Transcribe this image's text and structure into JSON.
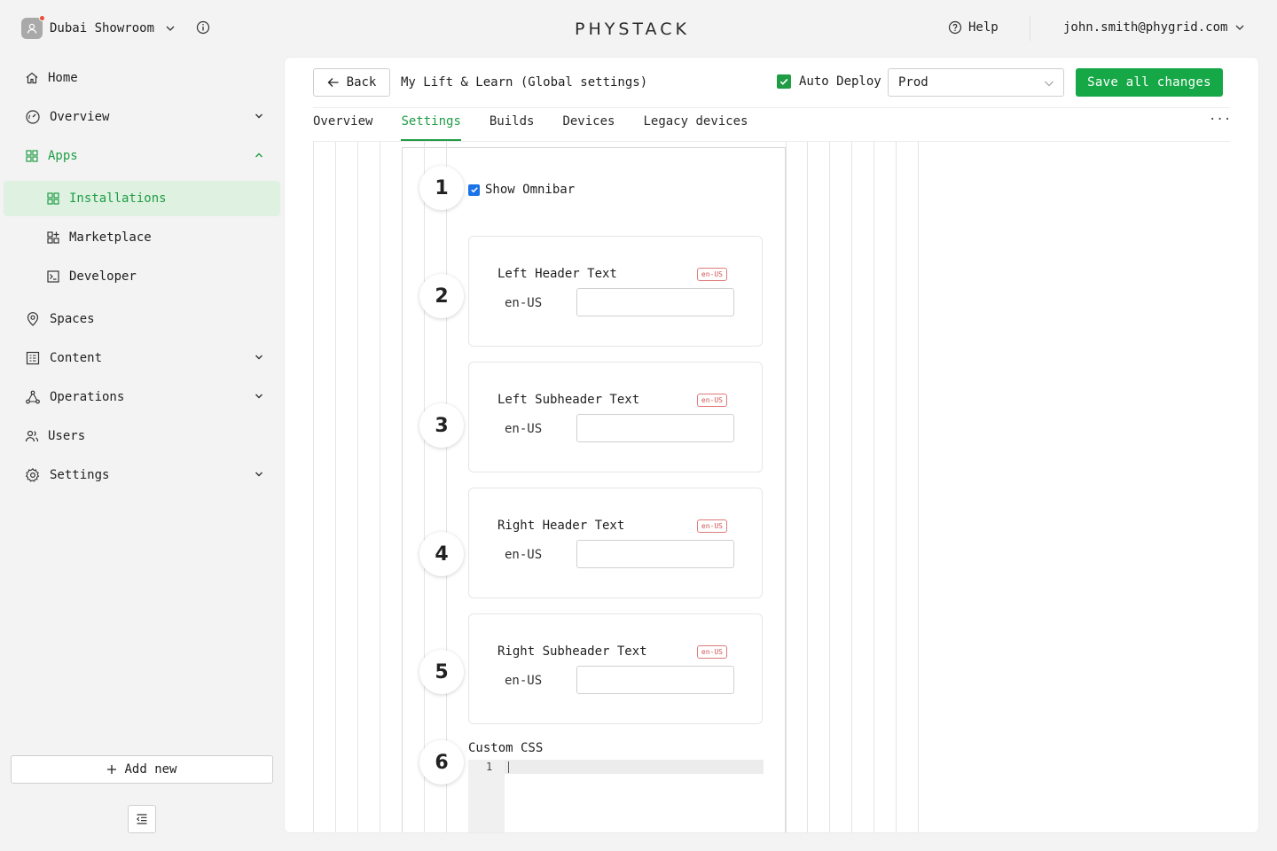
{
  "header": {
    "workspace_name": "Dubai Showroom",
    "logo_text": "PHYSTACK",
    "help_label": "Help",
    "user_email": "john.smith@phygrid.com"
  },
  "sidebar": {
    "items": [
      {
        "label": "Home",
        "icon": "home-icon"
      },
      {
        "label": "Overview",
        "icon": "gauge-icon"
      },
      {
        "label": "Apps",
        "icon": "grid-icon",
        "expanded": true
      },
      {
        "label": "Installations",
        "icon": "grid-icon",
        "active": true
      },
      {
        "label": "Marketplace",
        "icon": "grid-plus-icon"
      },
      {
        "label": "Developer",
        "icon": "terminal-icon"
      },
      {
        "label": "Spaces",
        "icon": "map-pin-icon"
      },
      {
        "label": "Content",
        "icon": "document-icon"
      },
      {
        "label": "Operations",
        "icon": "nodes-icon"
      },
      {
        "label": "Users",
        "icon": "users-icon"
      },
      {
        "label": "Settings",
        "icon": "gear-icon"
      }
    ],
    "add_new_label": "Add new"
  },
  "toolbar": {
    "back_label": "Back",
    "page_title": "My Lift & Learn (Global settings)",
    "auto_deploy_label": "Auto Deploy",
    "auto_deploy_checked": true,
    "environment_value": "Prod",
    "save_label": "Save all changes"
  },
  "tabs": [
    {
      "label": "Overview"
    },
    {
      "label": "Settings",
      "active": true
    },
    {
      "label": "Builds"
    },
    {
      "label": "Devices"
    },
    {
      "label": "Legacy devices"
    }
  ],
  "more_label": "···",
  "form": {
    "steps": [
      "1",
      "2",
      "3",
      "4",
      "5",
      "6"
    ],
    "show_omnibar_label": "Show Omnibar",
    "show_omnibar_checked": true,
    "fields": [
      {
        "label": "Left Header Text",
        "badge": "en-US",
        "locale": "en-US",
        "value": ""
      },
      {
        "label": "Left Subheader Text",
        "badge": "en-US",
        "locale": "en-US",
        "value": ""
      },
      {
        "label": "Right Header Text",
        "badge": "en-US",
        "locale": "en-US",
        "value": ""
      },
      {
        "label": "Right Subheader Text",
        "badge": "en-US",
        "locale": "en-US",
        "value": ""
      }
    ],
    "custom_css_label": "Custom CSS",
    "code_line_number": "1"
  },
  "colors": {
    "accent": "#1f9d45",
    "save_button": "#16a846",
    "active_bg": "#dff2e2",
    "badge": "#d45656",
    "checkbox_blue": "#1a73e8"
  }
}
